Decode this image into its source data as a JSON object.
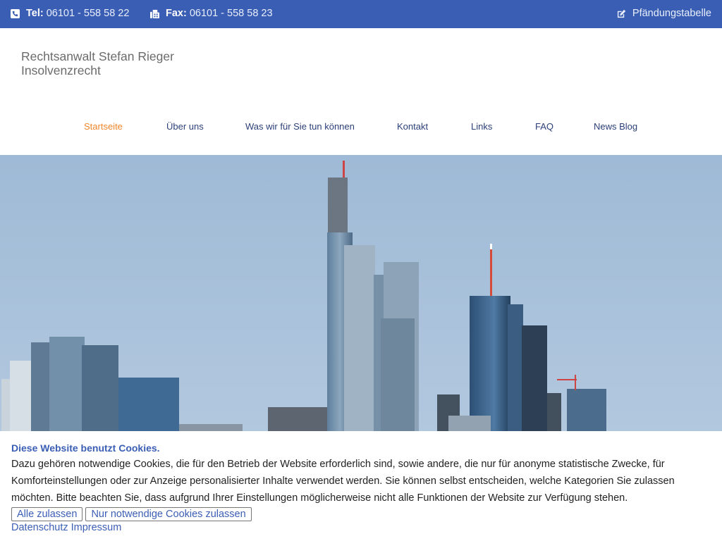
{
  "topbar": {
    "tel_label": "Tel:",
    "tel_value": "06101 - 558 58 22",
    "fax_label": "Fax:",
    "fax_value": "06101 - 558 58 23",
    "right_link": "Pfändungstabelle",
    "icons": [
      "phone-icon",
      "fax-icon",
      "edit-icon"
    ],
    "background": "#3b5eb5"
  },
  "brand": {
    "line1": "Rechtsanwalt Stefan Rieger",
    "line2": "Insolvenzrecht"
  },
  "nav": {
    "items": [
      {
        "label": "Startseite",
        "active": true
      },
      {
        "label": "Über uns",
        "active": false
      },
      {
        "label": "Was wir für Sie tun können",
        "active": false
      },
      {
        "label": "Kontakt",
        "active": false
      },
      {
        "label": "Links",
        "active": false
      },
      {
        "label": "FAQ",
        "active": false
      },
      {
        "label": "News Blog",
        "active": false
      }
    ],
    "active_color": "#f2862b",
    "color": "#2b3f78"
  },
  "cookie": {
    "title": "Diese Website benutzt Cookies.",
    "text": "Dazu gehören notwendige Cookies, die für den Betrieb der Website erforderlich sind, sowie andere, die nur für anonyme statistische Zwecke, für Komforteinstellungen oder zur Anzeige personalisierter Inhalte verwendet werden. Sie können selbst entscheiden, welche Kategorien Sie zulassen möchten. Bitte beachten Sie, dass aufgrund Ihrer Einstellungen möglicherweise nicht alle Funktionen der Website zur Verfügung stehen.",
    "accept_all": "Alle zulassen",
    "accept_necessary": "Nur notwendige Cookies zulassen",
    "privacy_link": "Datenschutz",
    "imprint_link": "Impressum"
  }
}
